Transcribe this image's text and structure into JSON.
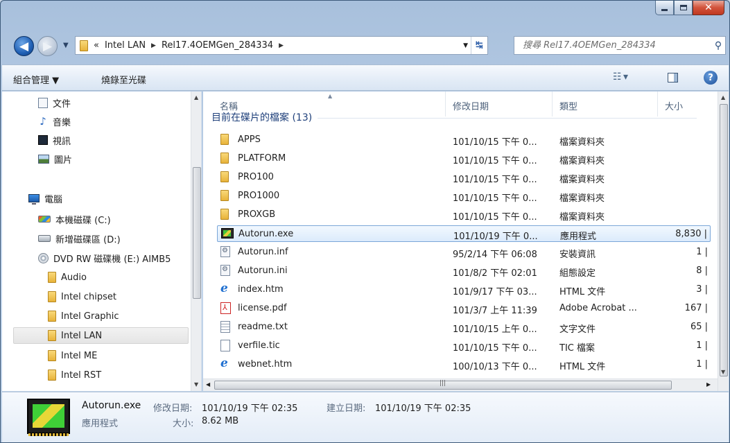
{
  "address": {
    "overflow": "«",
    "crumbs": [
      "Intel LAN",
      "Rel17.4OEMGen_284334"
    ]
  },
  "search": {
    "placeholder": "搜尋 Rel17.4OEMGen_284334"
  },
  "toolbar": {
    "organize": "組合管理 ▼",
    "burn": "燒錄至光碟"
  },
  "nav": {
    "items": [
      {
        "label": "文件",
        "icon": "documents-icon"
      },
      {
        "label": "音樂",
        "icon": "music-icon"
      },
      {
        "label": "視訊",
        "icon": "video-icon"
      },
      {
        "label": "圖片",
        "icon": "pictures-icon"
      },
      {
        "label": "電腦",
        "icon": "computer-icon"
      },
      {
        "label": "本機磁碟 (C:)",
        "icon": "drive-icon"
      },
      {
        "label": "新增磁碟區 (D:)",
        "icon": "drive-icon"
      },
      {
        "label": "DVD RW 磁碟機 (E:) AIMB5",
        "icon": "dvd-icon"
      },
      {
        "label": "Audio",
        "icon": "folder-icon"
      },
      {
        "label": "Intel chipset",
        "icon": "folder-icon"
      },
      {
        "label": "Intel Graphic",
        "icon": "folder-icon"
      },
      {
        "label": "Intel LAN",
        "icon": "folder-icon",
        "selected": true
      },
      {
        "label": "Intel ME",
        "icon": "folder-icon"
      },
      {
        "label": "Intel RST",
        "icon": "folder-icon"
      }
    ]
  },
  "list": {
    "columns": {
      "name": "名稱",
      "date": "修改日期",
      "type": "類型",
      "size": "大小"
    },
    "group_header": "目前在碟片的檔案 (13)",
    "rows": [
      {
        "name": "APPS",
        "date": "101/10/15 下午 0...",
        "type": "檔案資料夾",
        "size": "",
        "icon": "folder-icon"
      },
      {
        "name": "PLATFORM",
        "date": "101/10/15 下午 0...",
        "type": "檔案資料夾",
        "size": "",
        "icon": "folder-icon"
      },
      {
        "name": "PRO100",
        "date": "101/10/15 下午 0...",
        "type": "檔案資料夾",
        "size": "",
        "icon": "folder-icon"
      },
      {
        "name": "PRO1000",
        "date": "101/10/15 下午 0...",
        "type": "檔案資料夾",
        "size": "",
        "icon": "folder-icon"
      },
      {
        "name": "PROXGB",
        "date": "101/10/15 下午 0...",
        "type": "檔案資料夾",
        "size": "",
        "icon": "folder-icon"
      },
      {
        "name": "Autorun.exe",
        "date": "101/10/19 下午 0...",
        "type": "應用程式",
        "size": "8,830 |",
        "icon": "exe-icon",
        "selected": true
      },
      {
        "name": "Autorun.inf",
        "date": "95/2/14 下午 06:08",
        "type": "安裝資訊",
        "size": "1 |",
        "icon": "config-file-icon"
      },
      {
        "name": "Autorun.ini",
        "date": "101/8/2 下午 02:01",
        "type": "組態設定",
        "size": "8 |",
        "icon": "config-file-icon"
      },
      {
        "name": "index.htm",
        "date": "101/9/17 下午 03...",
        "type": "HTML 文件",
        "size": "3 |",
        "icon": "ie-html-icon"
      },
      {
        "name": "license.pdf",
        "date": "101/3/7 上午 11:39",
        "type": "Adobe Acrobat ...",
        "size": "167 |",
        "icon": "pdf-icon"
      },
      {
        "name": "readme.txt",
        "date": "101/10/15 上午 0...",
        "type": "文字文件",
        "size": "65 |",
        "icon": "text-file-icon"
      },
      {
        "name": "verfile.tic",
        "date": "101/10/15 下午 0...",
        "type": "TIC 檔案",
        "size": "1 |",
        "icon": "blank-file-icon"
      },
      {
        "name": "webnet.htm",
        "date": "100/10/13 下午 0...",
        "type": "HTML 文件",
        "size": "1 |",
        "icon": "ie-html-icon"
      }
    ]
  },
  "details": {
    "name": "Autorun.exe",
    "type": "應用程式",
    "modified_label": "修改日期:",
    "modified": "101/10/19 下午 02:35",
    "created_label": "建立日期:",
    "created": "101/10/19 下午 02:35",
    "size_label": "大小:",
    "size": "8.62 MB"
  }
}
